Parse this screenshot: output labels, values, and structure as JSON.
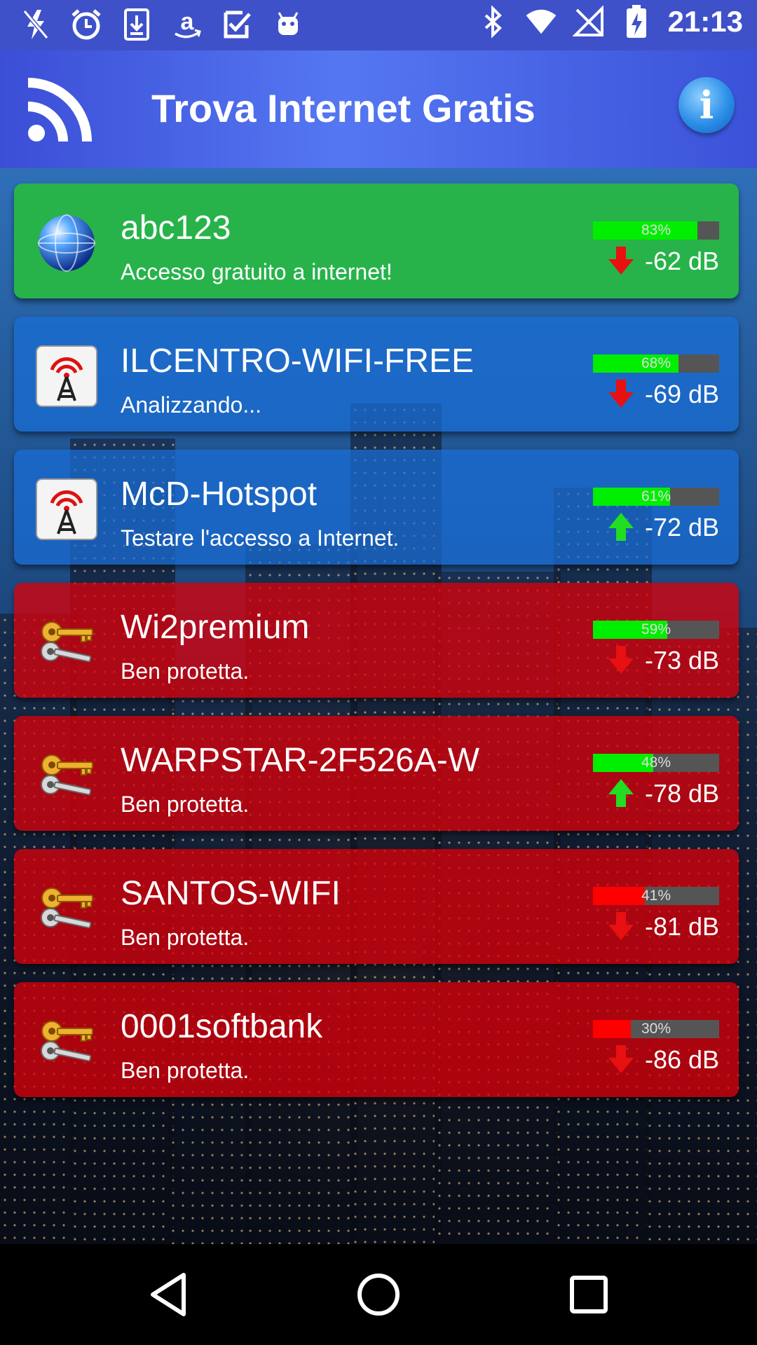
{
  "status_bar": {
    "time": "21:13",
    "left_icons": [
      "flash-off-icon",
      "alarm-icon",
      "download-icon",
      "amazon-icon",
      "checkbox-icon",
      "android-icon"
    ],
    "right_icons": [
      "bluetooth-icon",
      "wifi-icon",
      "signal-off-icon",
      "battery-charging-icon"
    ]
  },
  "app_bar": {
    "title": "Trova Internet Gratis",
    "left_icon": "rss-icon",
    "right_icon": "info-icon"
  },
  "networks": [
    {
      "ssid": "abc123",
      "status": "Accesso gratuito a internet!",
      "signal_percent": 83,
      "signal_percent_label": "83%",
      "db": "-62 dB",
      "trend": "down",
      "state": "free",
      "icon": "globe-icon"
    },
    {
      "ssid": "ILCENTRO-WIFI-FREE",
      "status": "Analizzando...",
      "signal_percent": 68,
      "signal_percent_label": "68%",
      "db": "-69 dB",
      "trend": "down",
      "state": "open",
      "icon": "antenna-tower-icon"
    },
    {
      "ssid": "McD-Hotspot",
      "status": "Testare l'accesso a Internet.",
      "signal_percent": 61,
      "signal_percent_label": "61%",
      "db": "-72 dB",
      "trend": "up",
      "state": "open",
      "icon": "antenna-tower-icon"
    },
    {
      "ssid": "Wi2premium",
      "status": "Ben protetta.",
      "signal_percent": 59,
      "signal_percent_label": "59%",
      "db": "-73 dB",
      "trend": "down",
      "state": "protected",
      "icon": "keys-icon"
    },
    {
      "ssid": "WARPSTAR-2F526A-W",
      "status": "Ben protetta.",
      "signal_percent": 48,
      "signal_percent_label": "48%",
      "db": "-78 dB",
      "trend": "up",
      "state": "protected",
      "icon": "keys-icon"
    },
    {
      "ssid": "SANTOS-WIFI",
      "status": "Ben protetta.",
      "signal_percent": 41,
      "signal_percent_label": "41%",
      "db": "-81 dB",
      "trend": "down",
      "state": "protected",
      "icon": "keys-icon"
    },
    {
      "ssid": "0001softbank",
      "status": "Ben protetta.",
      "signal_percent": 30,
      "signal_percent_label": "30%",
      "db": "-86 dB",
      "trend": "down",
      "state": "protected",
      "icon": "keys-icon"
    }
  ],
  "colors": {
    "status_bar": "#3f51c9",
    "card_free": "#27b34a",
    "card_open": "#1e6ed7",
    "card_protected": "#d7000a",
    "bar_strong": "#00ee00",
    "bar_weak": "#ff0000",
    "arrow_down": "#e81010",
    "arrow_up": "#22dd22"
  },
  "nav_bar": {
    "icons": [
      "back-icon",
      "home-icon",
      "recents-icon"
    ]
  }
}
